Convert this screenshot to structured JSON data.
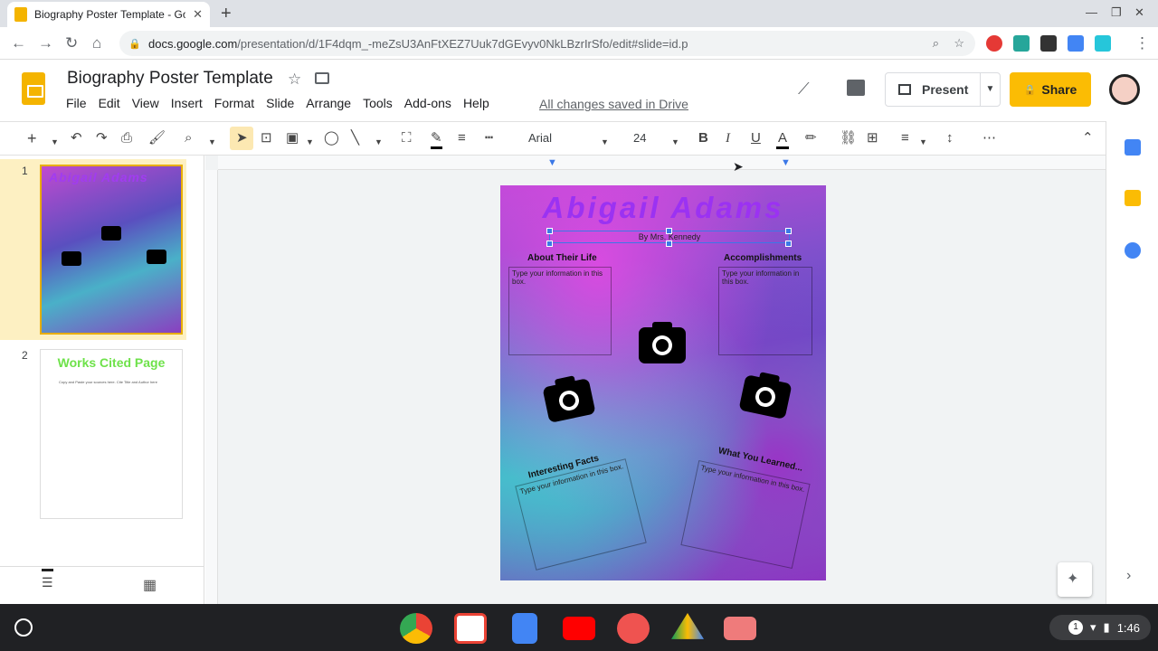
{
  "browser": {
    "tab_title": "Biography Poster Template - Goo",
    "url_domain": "docs.google.com",
    "url_path": "/presentation/d/1F4dqm_-meZsU3AnFtXEZ7Uuk7dGEvyv0NkLBzrIrSfo/edit#slide=id.p"
  },
  "doc": {
    "title": "Biography Poster Template",
    "saved_status": "All changes saved in Drive",
    "menu": [
      "File",
      "Edit",
      "View",
      "Insert",
      "Format",
      "Slide",
      "Arrange",
      "Tools",
      "Add-ons",
      "Help"
    ]
  },
  "actions": {
    "present": "Present",
    "share": "Share"
  },
  "toolbar": {
    "font": "Arial",
    "font_size": "24"
  },
  "filmstrip": {
    "slides": [
      {
        "number": "1",
        "title": "Abigail Adams"
      },
      {
        "number": "2",
        "title": "Works Cited Page",
        "body": "Copy and Paste your sources here. Cite Title and Author here"
      }
    ]
  },
  "slide": {
    "title": "Abigail Adams",
    "byline": "By Mrs. Kennedy",
    "sections": {
      "about": "About Their Life",
      "accomplishments": "Accomplishments",
      "facts": "Interesting Facts",
      "learned": "What You Learned..."
    },
    "placeholder": "Type your information in this box."
  },
  "system": {
    "time": "1:46",
    "notifications": "1"
  },
  "colors": {
    "accent_yellow": "#fbbc04",
    "title_purple": "#9b32f2",
    "works_cited_green": "#6ee24a"
  }
}
